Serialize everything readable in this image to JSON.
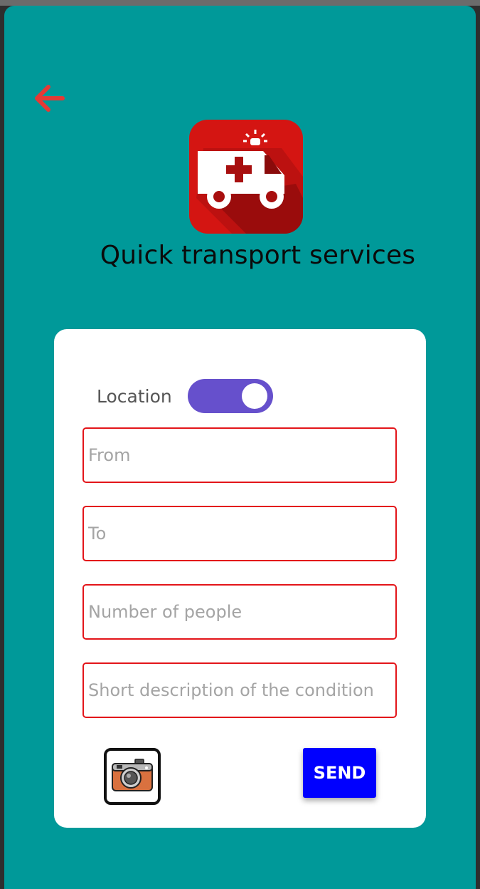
{
  "app": {
    "title": "Quick transport services"
  },
  "form": {
    "location_label": "Location",
    "location_enabled": true,
    "from_placeholder": "From",
    "to_placeholder": "To",
    "people_placeholder": "Number of people",
    "description_placeholder": "Short description of the condition",
    "send_label": "SEND"
  },
  "colors": {
    "background": "#009999",
    "back_arrow": "#e53935",
    "toggle_track": "#6650cc",
    "field_border": "#e3151a",
    "send_button": "#0000ff",
    "logo_red": "#cc1111"
  },
  "icons": {
    "back": "arrow-left-icon",
    "logo": "ambulance-icon",
    "camera": "camera-icon"
  }
}
